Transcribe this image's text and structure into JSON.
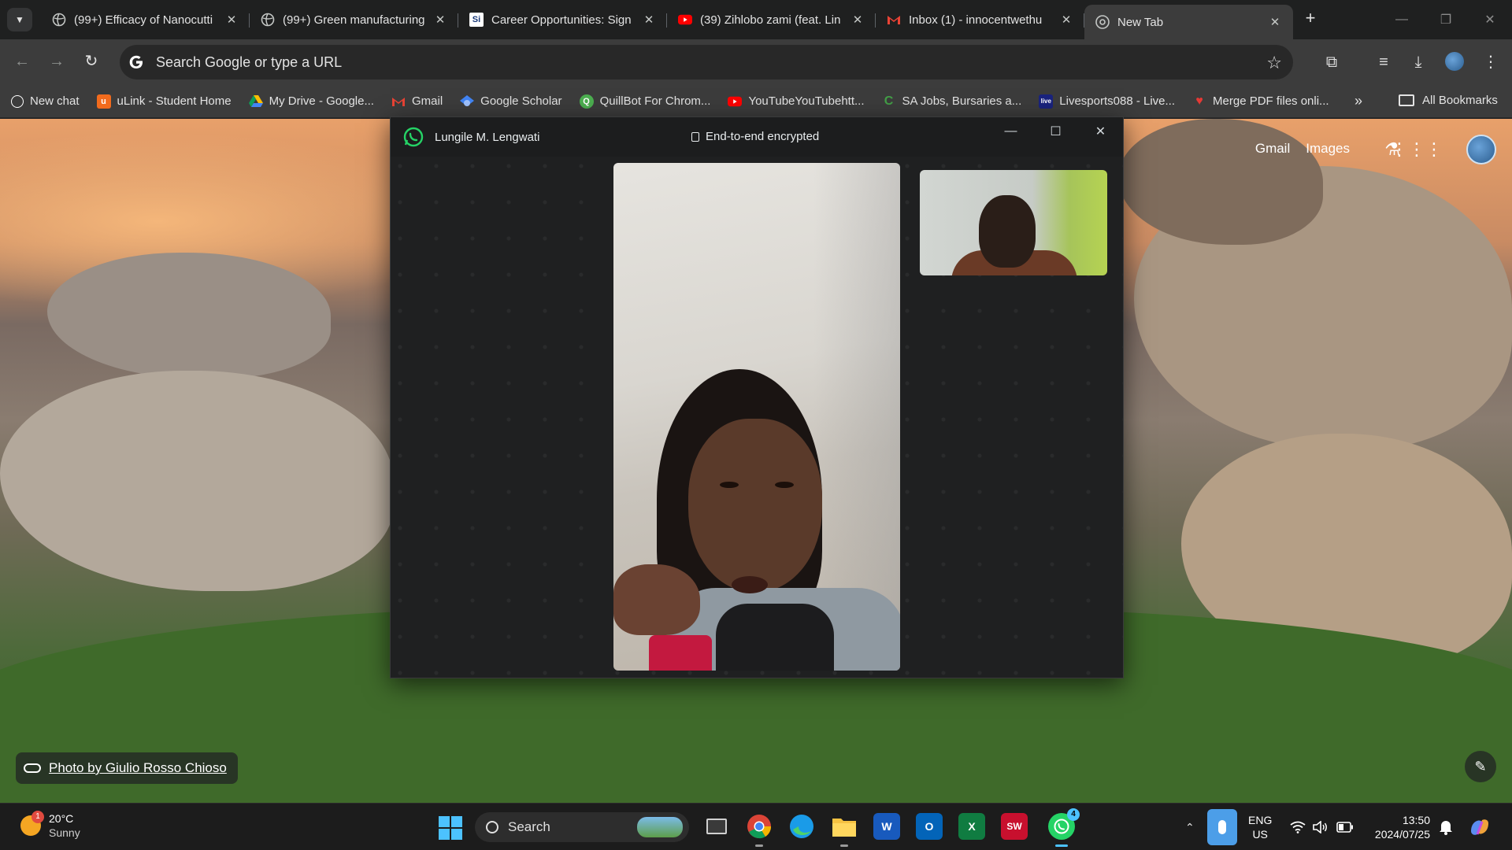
{
  "browser": {
    "tabs": [
      {
        "title": "(99+) Efficacy of Nanocutti",
        "icon": "globe-icon",
        "active": false
      },
      {
        "title": "(99+) Green manufacturing",
        "icon": "globe-icon",
        "active": false
      },
      {
        "title": "Career Opportunities: Sign",
        "icon": "si-icon",
        "active": false
      },
      {
        "title": "(39) Zihlobo zami (feat. Lin",
        "icon": "youtube-icon",
        "active": false
      },
      {
        "title": "Inbox (1) - innocentwethu",
        "icon": "gmail-icon",
        "active": false
      },
      {
        "title": "New Tab",
        "icon": "chrome-icon",
        "active": true
      }
    ],
    "omnibox": {
      "placeholder": "Search Google or type a URL"
    },
    "bookmarks": [
      {
        "label": "New chat",
        "icon": "chatgpt-icon",
        "color": "#ffffff"
      },
      {
        "label": "uLink - Student Home",
        "icon": "ulink-icon",
        "color": "#f26b1d"
      },
      {
        "label": "My Drive - Google...",
        "icon": "drive-icon",
        "color": "#fbbc04"
      },
      {
        "label": "Gmail",
        "icon": "gmail-icon",
        "color": "#ea4335"
      },
      {
        "label": "Google Scholar",
        "icon": "scholar-icon",
        "color": "#4285f4"
      },
      {
        "label": "QuillBot For Chrom...",
        "icon": "quillbot-icon",
        "color": "#4caf50"
      },
      {
        "label": "YouTubeYouTubehtt...",
        "icon": "youtube-icon",
        "color": "#ff0000"
      },
      {
        "label": "SA Jobs, Bursaries a...",
        "icon": "c-icon",
        "color": "#2e7d32"
      },
      {
        "label": "Livesports088 - Live...",
        "icon": "live-icon",
        "color": "#1a237e"
      },
      {
        "label": "Merge PDF files onli...",
        "icon": "pdf-icon",
        "color": "#e53935"
      }
    ],
    "all_bookmarks": "All Bookmarks"
  },
  "ntp": {
    "links": [
      "Gmail",
      "Images"
    ],
    "photo_credit": "Photo by Giulio Rosso Chioso"
  },
  "whatsapp": {
    "contact": "Lungile M. Lengwati",
    "encryption": "End-to-end encrypted",
    "accent": "#25d366"
  },
  "taskbar": {
    "weather": {
      "temp": "20°C",
      "condition": "Sunny",
      "badge": "1"
    },
    "search": "Search",
    "apps": [
      {
        "name": "task-view",
        "label": ""
      },
      {
        "name": "chrome",
        "label": ""
      },
      {
        "name": "edge",
        "label": ""
      },
      {
        "name": "file-explorer",
        "label": ""
      },
      {
        "name": "word",
        "label": "W"
      },
      {
        "name": "outlook",
        "label": "O"
      },
      {
        "name": "excel",
        "label": "X"
      },
      {
        "name": "solidworks",
        "label": "SW"
      },
      {
        "name": "whatsapp",
        "label": "",
        "badge": "4"
      }
    ],
    "language": {
      "line1": "ENG",
      "line2": "US"
    },
    "time": "13:50",
    "date": "2024/07/25"
  }
}
